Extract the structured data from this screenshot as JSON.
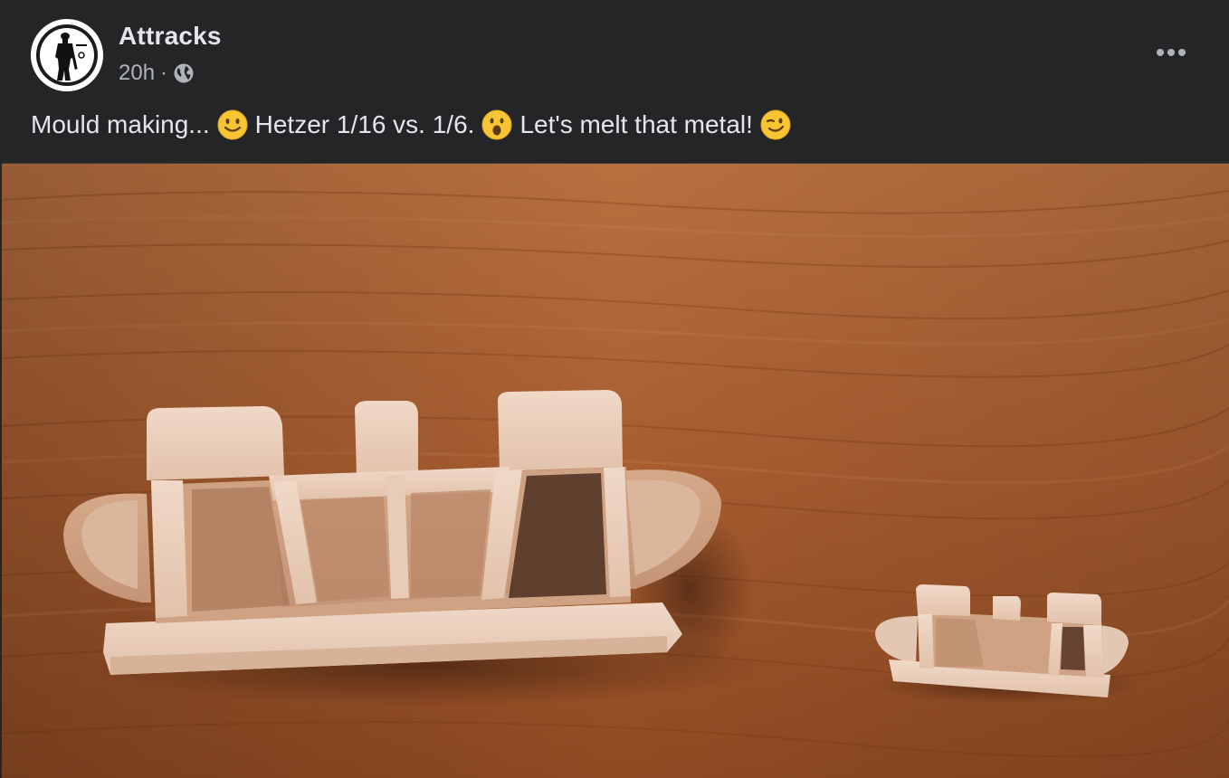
{
  "post": {
    "author": "Attracks",
    "time": "20h",
    "separator": "·",
    "audience_icon": "globe-icon",
    "more_icon": "more-horizontal-icon",
    "caption": {
      "part1": "Mould making...",
      "emoji1": "slightly-smiling-face",
      "part2": "Hetzer 1/16 vs. 1/6.",
      "emoji2": "face-with-open-mouth",
      "part3": "Let's melt that metal!",
      "emoji3": "winking-face"
    }
  },
  "colors": {
    "background": "#242526",
    "primary_text": "#e4e6eb",
    "secondary_text": "#b0b3b8",
    "wood": "#a6592e",
    "resin": "#e8ccb8"
  }
}
